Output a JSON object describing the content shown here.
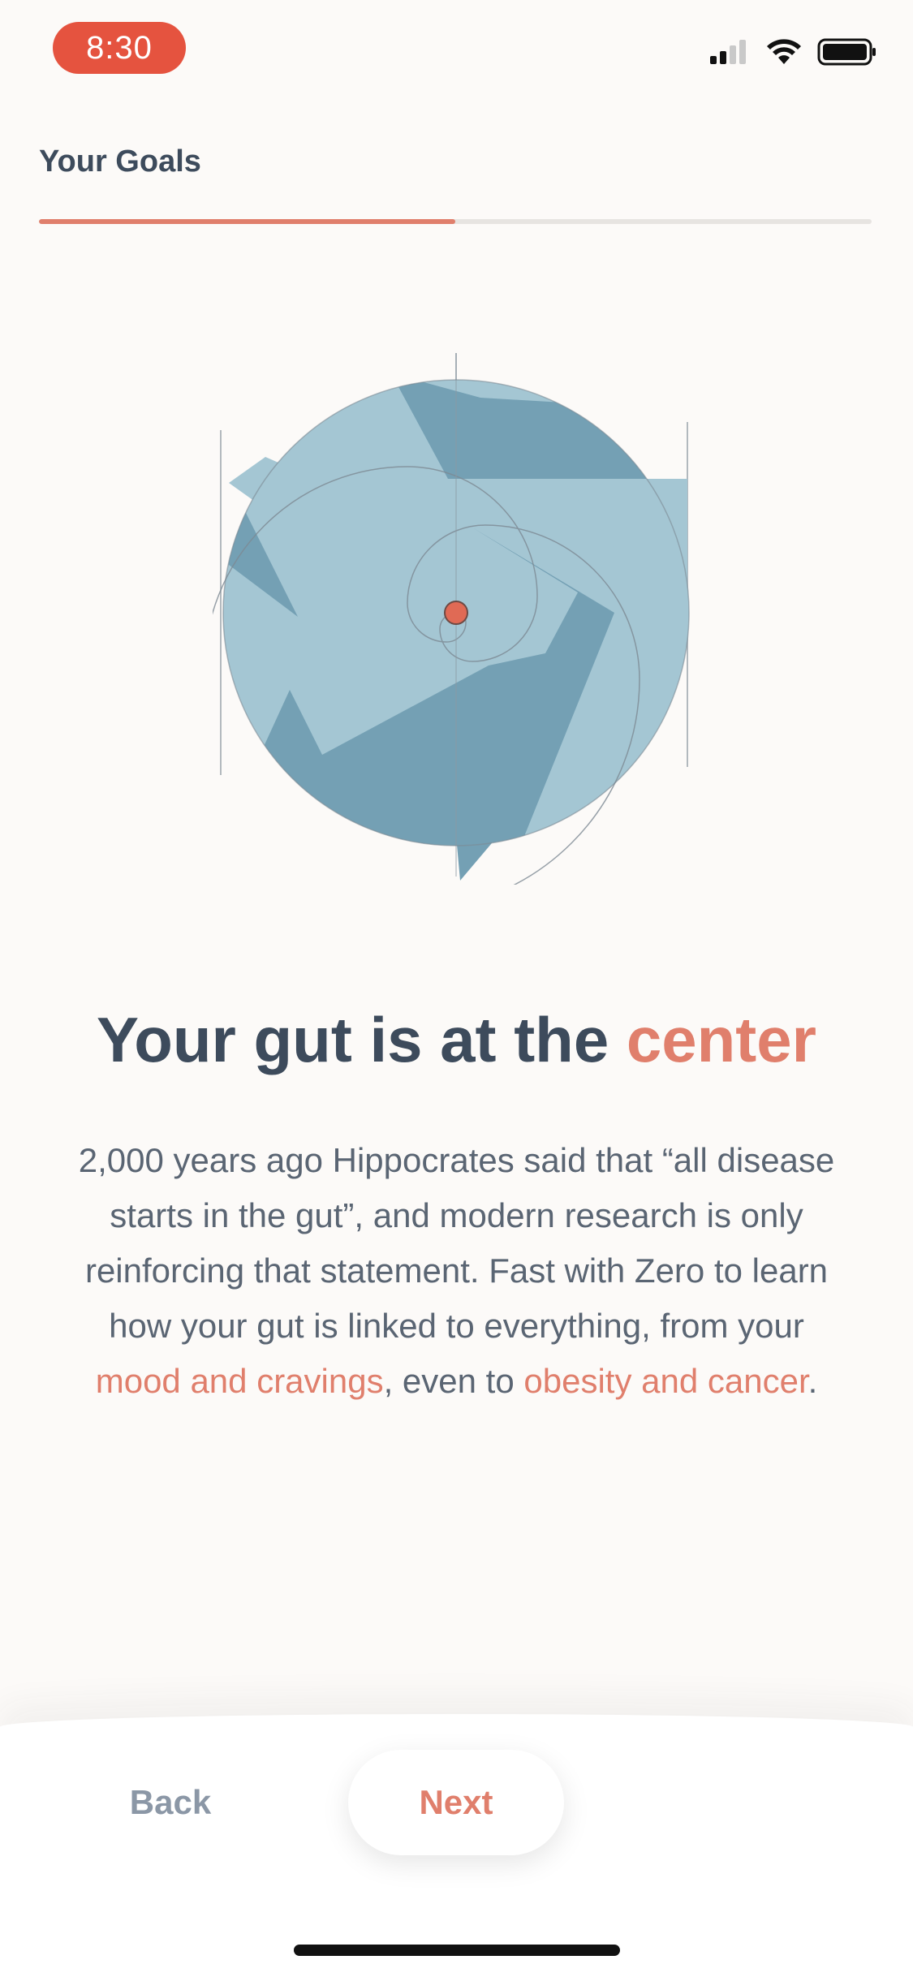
{
  "status_bar": {
    "time": "8:30",
    "colors": {
      "time_pill": "#e5533f"
    },
    "icons": [
      "cellular-signal-icon",
      "wifi-icon",
      "battery-icon"
    ]
  },
  "header": {
    "title": "Your Goals",
    "progress_fraction": 0.5
  },
  "illustration": {
    "icon": "gut-spiral-illustration",
    "colors": {
      "light": "#a4c6d3",
      "dark": "#74a0b4",
      "center_dot": "#e06a55"
    }
  },
  "headline": {
    "text_before": "Your gut is at the",
    "highlight": "center"
  },
  "body": {
    "text_1": "2,000 years ago Hippocrates said that “all disease starts in the gut”, and modern research is only reinforcing that statement. Fast with Zero to learn how your gut is linked to everything, from your ",
    "link_1": "mood and cravings",
    "text_2": ", even to ",
    "link_2": "obesity and cancer",
    "text_3": "."
  },
  "footer": {
    "back_label": "Back",
    "next_label": "Next"
  },
  "colors": {
    "accent": "#e07f6c",
    "heading": "#3d4b5c",
    "body_text": "#5a6573",
    "background": "#fcfaf8"
  }
}
